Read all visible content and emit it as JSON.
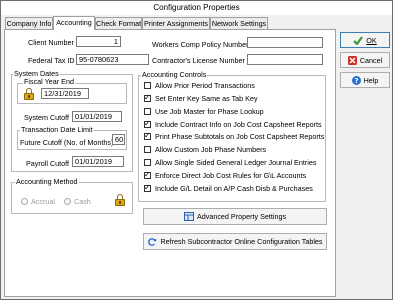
{
  "window": {
    "title": "Configuration Properties"
  },
  "tabs": [
    {
      "label": "Company Info"
    },
    {
      "label": "Accounting"
    },
    {
      "label": "Check Format"
    },
    {
      "label": "Printer Assignments"
    },
    {
      "label": "Network Settings"
    }
  ],
  "fields": {
    "client_number": {
      "label": "Client Number",
      "value": "1"
    },
    "federal_tax_id": {
      "label": "Federal Tax ID",
      "value": "95-0780623"
    },
    "workers_comp": {
      "label": "Workers Comp Policy Number",
      "value": ""
    },
    "contractors_license": {
      "label": "Contractor's License Number",
      "value": ""
    }
  },
  "system_dates": {
    "title": "System Dates",
    "fiscal_year_end": {
      "title": "Fiscal Year End",
      "value": "12/31/2019"
    },
    "system_cutoff": {
      "label": "System Cutoff",
      "value": "01/01/2019"
    },
    "transaction_date_limit": {
      "title": "Transaction Date Limit",
      "label": "Future Cutoff (No. of Months)",
      "value": "60"
    },
    "payroll_cutoff": {
      "label": "Payroll Cutoff",
      "value": "01/01/2019"
    }
  },
  "accounting_method": {
    "title": "Accounting Method",
    "options": [
      "Accrual",
      "Cash"
    ]
  },
  "accounting_controls": {
    "title": "Accounting Controls",
    "items": [
      {
        "label": "Allow Prior Period Transactions",
        "checked": false
      },
      {
        "label": "Set Enter Key Same as Tab Key",
        "checked": true
      },
      {
        "label": "Use Job Master for Phase Lookup",
        "checked": false
      },
      {
        "label": "Include Contract Info on Job Cost Capsheet Reports",
        "checked": true
      },
      {
        "label": "Print Phase Subtotals on Job Cost Capsheet Reports",
        "checked": true
      },
      {
        "label": "Allow Custom Job Phase Numbers",
        "checked": false
      },
      {
        "label": "Allow Single Sided General Ledger Journal Entries",
        "checked": false
      },
      {
        "label": "Enforce Direct Job Cost Rules for G\\L Accounts",
        "checked": true
      },
      {
        "label": "Include G/L Detail on A/P Cash Disb & Purchases",
        "checked": true
      }
    ]
  },
  "buttons": {
    "advanced": "Advanced Property Settings",
    "refresh": "Refresh Subcontractor Online Configuration Tables",
    "ok": "OK",
    "cancel": "Cancel",
    "help": "Help"
  },
  "colors": {
    "ok": "#2a9a2a",
    "cancel": "#d0302a",
    "help": "#2a6fd0"
  }
}
